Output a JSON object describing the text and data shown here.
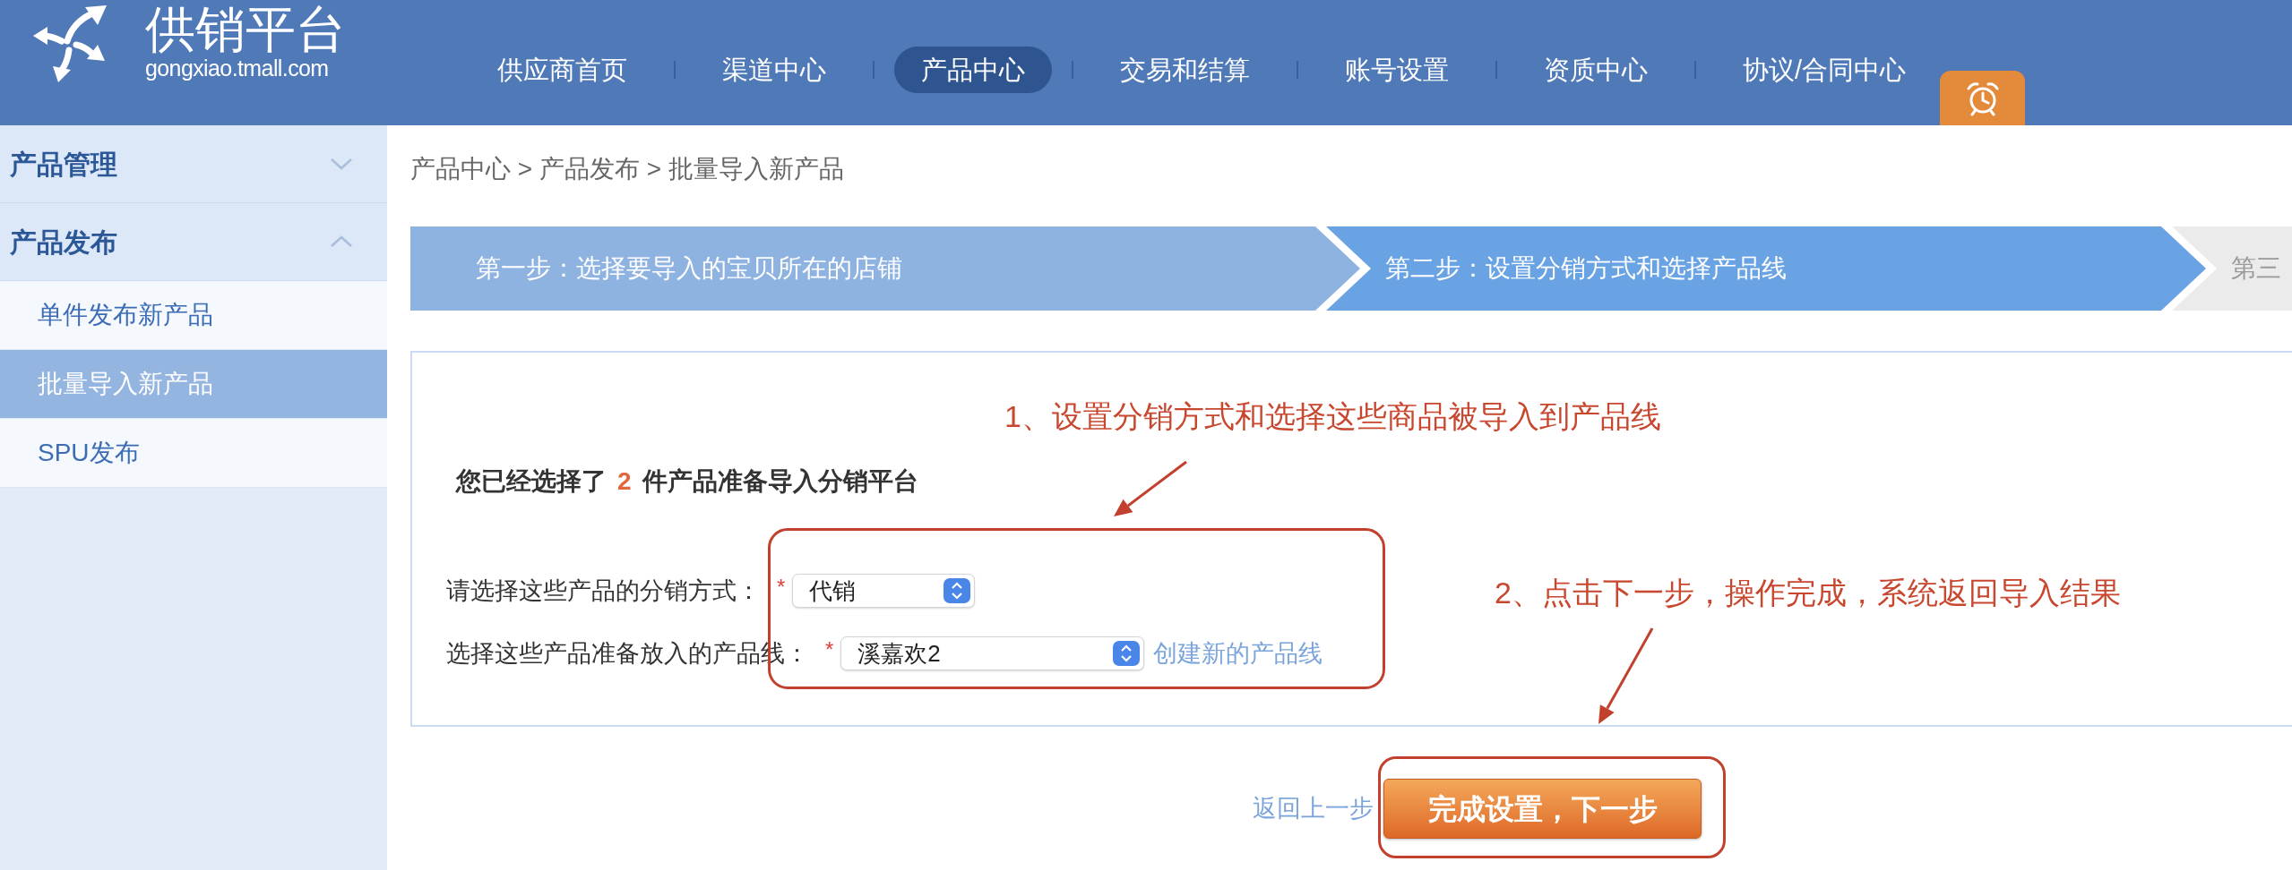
{
  "header": {
    "logo": {
      "title": "供销平台",
      "domain": "gongxiao.tmall.com"
    },
    "nav": [
      {
        "label": "供应商首页",
        "selected": false
      },
      {
        "label": "渠道中心",
        "selected": false
      },
      {
        "label": "产品中心",
        "selected": true
      },
      {
        "label": "交易和结算",
        "selected": false
      },
      {
        "label": "账号设置",
        "selected": false
      },
      {
        "label": "资质中心",
        "selected": false
      },
      {
        "label": "协议/合同中心",
        "selected": false
      }
    ]
  },
  "sidebar": {
    "groups": [
      {
        "label": "产品管理",
        "expanded": false
      },
      {
        "label": "产品发布",
        "expanded": true,
        "children": [
          {
            "label": "单件发布新产品",
            "selected": false
          },
          {
            "label": "批量导入新产品",
            "selected": true
          },
          {
            "label": "SPU发布",
            "selected": false
          }
        ]
      }
    ]
  },
  "breadcrumb": "产品中心 > 产品发布 > 批量导入新产品",
  "steps": [
    {
      "label": "第一步：选择要导入的宝贝所在的店铺",
      "completed": true,
      "selected": false
    },
    {
      "label": "第二步：设置分销方式和选择产品线",
      "completed": false,
      "selected": true
    },
    {
      "label": "第三",
      "completed": false,
      "selected": false
    }
  ],
  "form": {
    "summary": {
      "before": "您已经选择了",
      "count": "2",
      "after": "件产品准备导入分销平台"
    },
    "fields": [
      {
        "label": "请选择这些产品的分销方式：",
        "required_mark": "*",
        "value": "代销"
      },
      {
        "label": "选择这些产品准备放入的产品线：",
        "required_mark": "*",
        "value": "溪嘉欢2",
        "link": "创建新的产品线"
      }
    ]
  },
  "actions": {
    "back_link": "返回上一步",
    "next_button": "完成设置，下一步"
  },
  "annotations": [
    {
      "text": "1、设置分销方式和选择这些商品被导入到产品线"
    },
    {
      "text": "2、点击下一步，操作完成，系统返回导入结果"
    }
  ]
}
